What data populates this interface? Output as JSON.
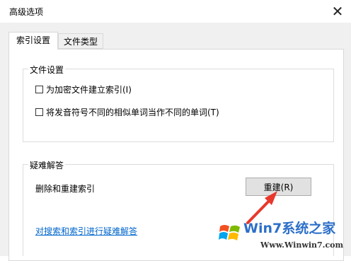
{
  "window": {
    "title": "高级选项",
    "close_glyph": "✕"
  },
  "tabs": [
    {
      "label": "索引设置",
      "active": true
    },
    {
      "label": "文件类型",
      "active": false
    }
  ],
  "file_settings": {
    "group_label": "文件设置",
    "options": [
      {
        "label": "为加密文件建立索引(I)",
        "checked": false
      },
      {
        "label": "将发音符号不同的相似单词当作不同的单词(T)",
        "checked": false
      }
    ]
  },
  "troubleshooting": {
    "group_label": "疑难解答",
    "rebuild_description": "删除和重建索引",
    "rebuild_button": "重建(R)",
    "troubleshoot_link": "对搜索和索引进行疑难解答"
  },
  "watermark": {
    "brand": "Win7系统之家",
    "url": "Www.Winwin7.com"
  },
  "colors": {
    "annotation_arrow": "#e8382c",
    "link": "#0066cc",
    "watermark_text": "#2c6fc9"
  }
}
